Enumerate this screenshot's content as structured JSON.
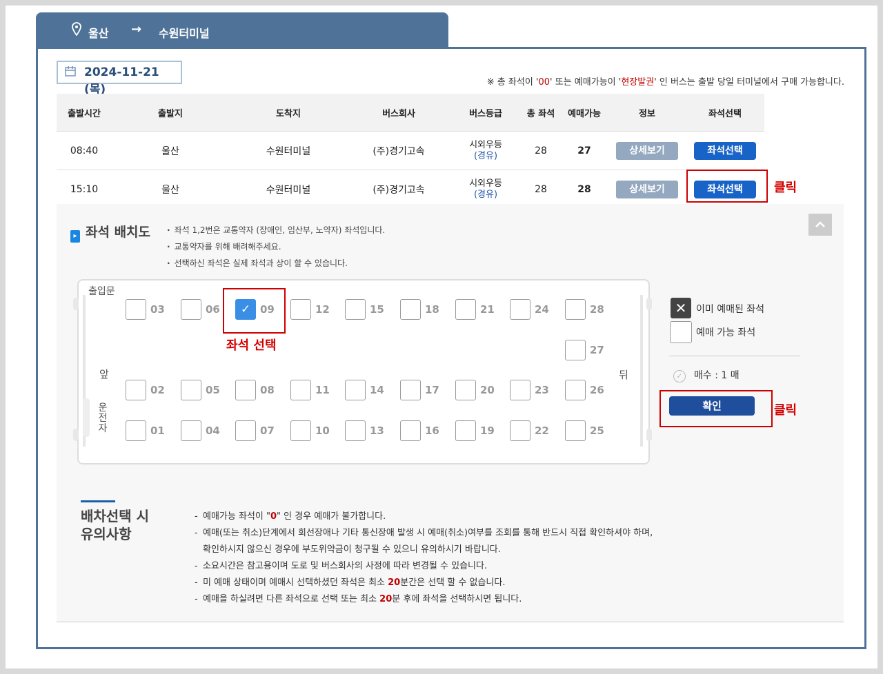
{
  "route": {
    "from": "울산",
    "arrow": "→",
    "to": "수원터미널"
  },
  "date": "2024-11-21 (목)",
  "notice_top": {
    "pre": "※ 총 좌석이 '",
    "zero": "00",
    "mid": "' 또는 예매가능이 '",
    "onsite": "현장발권",
    "post": "' 인 버스는 출발 당일 터미널에서 구매 가능합니다."
  },
  "table": {
    "headers": [
      "출발시간",
      "출발지",
      "도착지",
      "버스회사",
      "버스등급",
      "총 좌석",
      "예매가능",
      "정보",
      "좌석선택"
    ],
    "rows": [
      {
        "time": "08:40",
        "from": "울산",
        "to": "수원터미널",
        "company": "(주)경기고속",
        "grade": "시외우등",
        "via": "(경유)",
        "total": "28",
        "avail": "27",
        "detail": "상세보기",
        "select": "좌석선택"
      },
      {
        "time": "15:10",
        "from": "울산",
        "to": "수원터미널",
        "company": "(주)경기고속",
        "grade": "시외우등",
        "via": "(경유)",
        "total": "28",
        "avail": "28",
        "detail": "상세보기",
        "select": "좌석선택"
      }
    ]
  },
  "annotations": {
    "click1": "클릭",
    "seat_select": "좌석 선택",
    "click2": "클릭"
  },
  "seatmap": {
    "title": "좌석 배치도",
    "notes": [
      "좌석 1,2번은 교통약자 (장애인, 임산부, 노약자) 좌석입니다.",
      "교통약자를 위해 배려해주세요.",
      "선택하신 좌석은 실제 좌석과 상이 할 수 있습니다."
    ],
    "entrance": "출입문",
    "front": "앞",
    "back": "뒤",
    "driver": "운전자",
    "seats": {
      "s03": "03",
      "s06": "06",
      "s09": "09",
      "s12": "12",
      "s15": "15",
      "s18": "18",
      "s21": "21",
      "s24": "24",
      "s28": "28",
      "s27": "27",
      "s02": "02",
      "s05": "05",
      "s08": "08",
      "s11": "11",
      "s14": "14",
      "s17": "17",
      "s20": "20",
      "s23": "23",
      "s26": "26",
      "s01": "01",
      "s04": "04",
      "s07": "07",
      "s10": "10",
      "s13": "13",
      "s16": "16",
      "s19": "19",
      "s22": "22",
      "s25": "25"
    },
    "selected_seat": "09",
    "legend": {
      "reserved": "이미 예매된 좌석",
      "available": "예매 가능 좌석",
      "reserved_symbol": "✕"
    },
    "count": "매수 : 1 매",
    "confirm": "확인"
  },
  "caution": {
    "title_line1": "배차선택 시",
    "title_line2": "유의사항",
    "items": {
      "i1_pre": "예매가능 좌석이 \"",
      "i1_zero": "0",
      "i1_post": "\" 인 경우 예매가 불가합니다.",
      "i2_line1": "예매(또는 취소)단계에서 회선장애나 기타 통신장애 발생 시 예매(취소)여부를 조회를 통해 반드시 직접 확인하셔야 하며,",
      "i2_line2": "확인하시지 않으신 경우에 부도위약금이 청구될 수 있으니 유의하시기 바랍니다.",
      "i3": "소요시간은 참고용이며 도로 및 버스회사의 사정에 따라 변경될 수 있습니다.",
      "i4_pre": "미 예매 상태이며 예매시 선택하셨던 좌석은 최소 ",
      "i4_num": "20",
      "i4_post": "분간은 선택 할 수 없습니다.",
      "i5_pre": "예매을 하실려면 다른 좌석으로 선택 또는 최소 ",
      "i5_num": "20",
      "i5_post": "분 후에 좌석을 선택하시면 됩니다."
    }
  },
  "colors": {
    "tab": "#4f7398",
    "seat_button": "#1863c7",
    "annotation_red": "#cc0000",
    "confirm": "#1f4e9c"
  },
  "icons": [
    "location-pin-icon",
    "calendar-icon",
    "chevron-up-icon",
    "check-icon",
    "close-icon"
  ]
}
